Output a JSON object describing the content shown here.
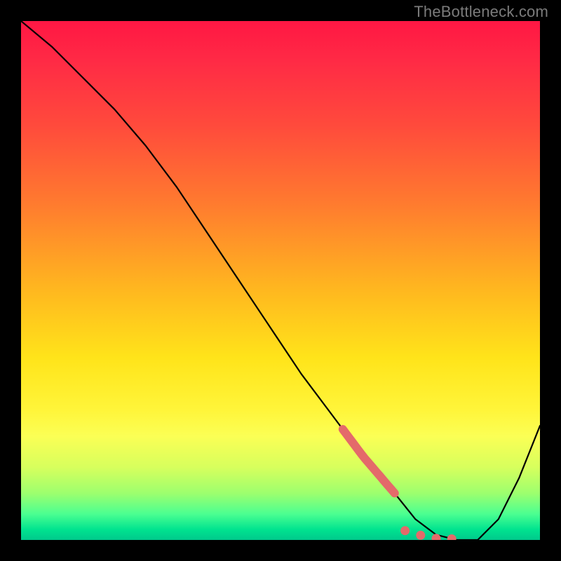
{
  "watermark": "TheBottleneck.com",
  "colors": {
    "background": "#000000",
    "gradient_top": "#ff1744",
    "gradient_mid": "#ffe41a",
    "gradient_bottom": "#00c98c",
    "curve": "#000000",
    "marker": "#e46a6a"
  },
  "chart_data": {
    "type": "line",
    "title": "",
    "xlabel": "",
    "ylabel": "",
    "xlim": [
      0,
      100
    ],
    "ylim": [
      0,
      100
    ],
    "series": [
      {
        "name": "bottleneck-curve",
        "x": [
          0,
          6,
          12,
          18,
          24,
          30,
          36,
          42,
          48,
          54,
          60,
          66,
          72,
          76,
          80,
          84,
          88,
          92,
          96,
          100
        ],
        "y": [
          100,
          95,
          89,
          83,
          76,
          68,
          59,
          50,
          41,
          32,
          24,
          16,
          9,
          4,
          1,
          0,
          0,
          4,
          12,
          22
        ]
      }
    ],
    "highlight_segment": {
      "name": "marker-dash",
      "x_start": 62,
      "x_end": 72,
      "style": "thick-dashed"
    },
    "highlight_dots": {
      "name": "optimal-points",
      "x": [
        74,
        77,
        80,
        83
      ],
      "y": [
        1.8,
        0.9,
        0.3,
        0.2
      ]
    }
  }
}
